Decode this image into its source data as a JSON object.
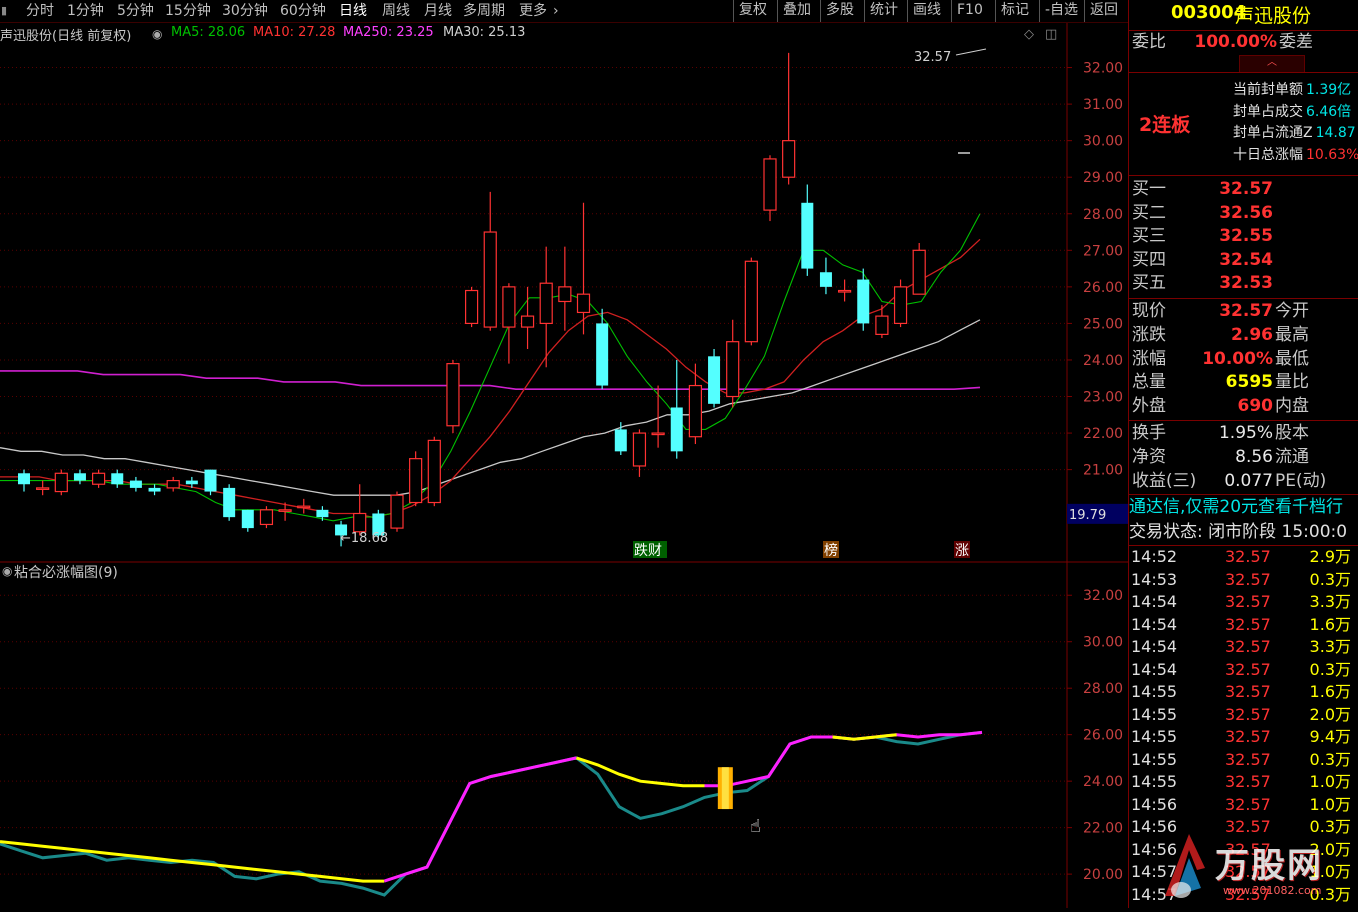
{
  "toolbar": {
    "tabs": [
      "分时",
      "1分钟",
      "5分钟",
      "15分钟",
      "30分钟",
      "60分钟",
      "日线",
      "周线",
      "月线",
      "多周期",
      "更多"
    ],
    "active_tab": "日线",
    "buttons": [
      "复权",
      "叠加",
      "多股",
      "统计",
      "画线",
      "F10",
      "标记",
      "-自选",
      "返回"
    ]
  },
  "main_legend": {
    "title": "声迅股份(日线 前复权)",
    "ma5": "MA5: 28.06",
    "ma10": "MA10: 27.28",
    "ma250": "MA250: 23.25",
    "ma30": "MA30: 25.13"
  },
  "colors": {
    "up": "#ff3232",
    "down": "#54ffff",
    "ma5": "#00c000",
    "ma10": "#d02020",
    "ma250": "#d020d0",
    "ma30": "#c8c8c8",
    "grid": "#5a0000"
  },
  "main_axis": {
    "labels": [
      "32.00",
      "31.00",
      "30.00",
      "29.00",
      "28.00",
      "27.00",
      "26.00",
      "25.00",
      "24.00",
      "23.00",
      "22.00",
      "21.00"
    ],
    "current": "19.79"
  },
  "annotations": {
    "high_label": "32.57",
    "low_label": "18.68",
    "markers": [
      "跌财",
      "榜",
      "涨"
    ]
  },
  "sub_chart": {
    "title": "粘合必涨幅图(9)",
    "axis_labels": [
      "32.00",
      "30.00",
      "28.00",
      "26.00",
      "24.00",
      "22.00",
      "20.00"
    ]
  },
  "stock": {
    "code": "003004",
    "name": "声迅股份",
    "weibi_label": "委比",
    "weibi_value": "100.00%",
    "weicha_label": "委差",
    "lianban": "2连板",
    "info": [
      {
        "label": "当前封单额",
        "value": "1.39亿"
      },
      {
        "label": "封单占成交",
        "value": "6.46倍"
      },
      {
        "label": "封单占流通Z",
        "value": "14.87"
      },
      {
        "label": "十日总涨幅",
        "value": "10.63%"
      }
    ],
    "buy": [
      {
        "label": "买一",
        "price": "32.57"
      },
      {
        "label": "买二",
        "price": "32.56"
      },
      {
        "label": "买三",
        "price": "32.55"
      },
      {
        "label": "买四",
        "price": "32.54"
      },
      {
        "label": "买五",
        "price": "32.53"
      }
    ],
    "quote": [
      {
        "label": "现价",
        "value": "32.57",
        "label2": "今开",
        "cls": "red"
      },
      {
        "label": "涨跌",
        "value": "2.96",
        "label2": "最高",
        "cls": "red"
      },
      {
        "label": "涨幅",
        "value": "10.00%",
        "label2": "最低",
        "cls": "red"
      },
      {
        "label": "总量",
        "value": "6595",
        "label2": "量比",
        "cls": "yellow"
      },
      {
        "label": "外盘",
        "value": "690",
        "label2": "内盘",
        "cls": "red"
      }
    ],
    "quote2": [
      {
        "label": "换手",
        "value": "1.95%",
        "label2": "股本"
      },
      {
        "label": "净资",
        "value": "8.56",
        "label2": "流通"
      },
      {
        "label": "收益(三)",
        "value": "0.077",
        "label2": "PE(动)"
      }
    ],
    "promo": "通达信,仅需20元查看千档行",
    "status": "交易状态: 闭市阶段 15:00:0",
    "ticks": [
      {
        "time": "14:52",
        "price": "32.57",
        "vol": "2.9万"
      },
      {
        "time": "14:53",
        "price": "32.57",
        "vol": "0.3万"
      },
      {
        "time": "14:54",
        "price": "32.57",
        "vol": "3.3万"
      },
      {
        "time": "14:54",
        "price": "32.57",
        "vol": "1.6万"
      },
      {
        "time": "14:54",
        "price": "32.57",
        "vol": "3.3万"
      },
      {
        "time": "14:54",
        "price": "32.57",
        "vol": "0.3万"
      },
      {
        "time": "14:55",
        "price": "32.57",
        "vol": "1.6万"
      },
      {
        "time": "14:55",
        "price": "32.57",
        "vol": "2.0万"
      },
      {
        "time": "14:55",
        "price": "32.57",
        "vol": "9.4万"
      },
      {
        "time": "14:55",
        "price": "32.57",
        "vol": "0.3万"
      },
      {
        "time": "14:55",
        "price": "32.57",
        "vol": "1.0万"
      },
      {
        "time": "14:56",
        "price": "32.57",
        "vol": "1.0万"
      },
      {
        "time": "14:56",
        "price": "32.57",
        "vol": "0.3万"
      },
      {
        "time": "14:56",
        "price": "32.57",
        "vol": "2.0万"
      },
      {
        "time": "14:57",
        "price": "32.57",
        "vol": "1.0万"
      },
      {
        "time": "14:57",
        "price": "32.57",
        "vol": "0.3万"
      }
    ],
    "watermark": "万股网",
    "watermark_url": "www.201082.com"
  },
  "chart_data": {
    "type": "candlestick",
    "ymin": 18.5,
    "ymax": 33.0,
    "candles": [
      {
        "o": 20.9,
        "c": 20.6,
        "h": 21.0,
        "l": 20.4
      },
      {
        "o": 20.5,
        "c": 20.5,
        "h": 20.7,
        "l": 20.3
      },
      {
        "o": 20.4,
        "c": 20.9,
        "h": 21.0,
        "l": 20.3
      },
      {
        "o": 20.9,
        "c": 20.7,
        "h": 21.0,
        "l": 20.6
      },
      {
        "o": 20.6,
        "c": 20.9,
        "h": 21.0,
        "l": 20.5
      },
      {
        "o": 20.9,
        "c": 20.6,
        "h": 21.0,
        "l": 20.5
      },
      {
        "o": 20.7,
        "c": 20.5,
        "h": 20.8,
        "l": 20.4
      },
      {
        "o": 20.5,
        "c": 20.4,
        "h": 20.6,
        "l": 20.3
      },
      {
        "o": 20.5,
        "c": 20.7,
        "h": 20.8,
        "l": 20.4
      },
      {
        "o": 20.7,
        "c": 20.6,
        "h": 20.8,
        "l": 20.5
      },
      {
        "o": 21.0,
        "c": 20.4,
        "h": 21.0,
        "l": 20.3
      },
      {
        "o": 20.5,
        "c": 19.7,
        "h": 20.6,
        "l": 19.6
      },
      {
        "o": 19.9,
        "c": 19.4,
        "h": 19.9,
        "l": 19.3
      },
      {
        "o": 19.5,
        "c": 19.9,
        "h": 20.0,
        "l": 19.4
      },
      {
        "o": 19.9,
        "c": 19.9,
        "h": 20.1,
        "l": 19.6
      },
      {
        "o": 20.0,
        "c": 20.0,
        "h": 20.2,
        "l": 19.8
      },
      {
        "o": 19.9,
        "c": 19.7,
        "h": 20.0,
        "l": 19.6
      },
      {
        "o": 19.5,
        "c": 19.2,
        "h": 19.6,
        "l": 18.9
      },
      {
        "o": 19.3,
        "c": 19.8,
        "h": 20.6,
        "l": 19.2
      },
      {
        "o": 19.8,
        "c": 19.2,
        "h": 19.9,
        "l": 19.1
      },
      {
        "o": 19.4,
        "c": 20.3,
        "h": 20.4,
        "l": 19.3
      },
      {
        "o": 20.1,
        "c": 21.3,
        "h": 21.5,
        "l": 20.0
      },
      {
        "o": 20.1,
        "c": 21.8,
        "h": 21.9,
        "l": 20.0
      },
      {
        "o": 22.2,
        "c": 23.9,
        "h": 24.0,
        "l": 22.0
      },
      {
        "o": 25.0,
        "c": 25.9,
        "h": 26.0,
        "l": 24.9
      },
      {
        "o": 24.9,
        "c": 27.5,
        "h": 28.6,
        "l": 24.8
      },
      {
        "o": 24.9,
        "c": 26.0,
        "h": 26.1,
        "l": 23.9
      },
      {
        "o": 24.9,
        "c": 25.2,
        "h": 26.0,
        "l": 24.3
      },
      {
        "o": 25.0,
        "c": 26.1,
        "h": 27.1,
        "l": 23.8
      },
      {
        "o": 25.6,
        "c": 26.0,
        "h": 27.1,
        "l": 24.8
      },
      {
        "o": 25.3,
        "c": 25.8,
        "h": 28.3,
        "l": 24.7
      },
      {
        "o": 25.0,
        "c": 23.3,
        "h": 25.4,
        "l": 23.2
      },
      {
        "o": 22.1,
        "c": 21.5,
        "h": 22.3,
        "l": 21.4
      },
      {
        "o": 21.1,
        "c": 22.0,
        "h": 22.1,
        "l": 20.8
      },
      {
        "o": 22.0,
        "c": 22.0,
        "h": 23.3,
        "l": 21.6
      },
      {
        "o": 22.7,
        "c": 21.5,
        "h": 24.0,
        "l": 21.3
      },
      {
        "o": 21.9,
        "c": 23.3,
        "h": 23.9,
        "l": 21.7
      },
      {
        "o": 24.1,
        "c": 22.8,
        "h": 24.3,
        "l": 22.7
      },
      {
        "o": 23.0,
        "c": 24.5,
        "h": 25.1,
        "l": 22.7
      },
      {
        "o": 24.5,
        "c": 26.7,
        "h": 26.8,
        "l": 24.4
      },
      {
        "o": 28.1,
        "c": 29.5,
        "h": 29.6,
        "l": 27.8
      },
      {
        "o": 29.0,
        "c": 30.0,
        "h": 32.4,
        "l": 28.8
      },
      {
        "o": 28.3,
        "c": 26.5,
        "h": 28.8,
        "l": 26.3
      },
      {
        "o": 26.4,
        "c": 26.0,
        "h": 26.8,
        "l": 25.8
      },
      {
        "o": 25.9,
        "c": 25.9,
        "h": 26.2,
        "l": 25.6
      },
      {
        "o": 26.2,
        "c": 25.0,
        "h": 26.5,
        "l": 24.8
      },
      {
        "o": 24.7,
        "c": 25.2,
        "h": 25.5,
        "l": 24.6
      },
      {
        "o": 25.0,
        "c": 26.0,
        "h": 26.2,
        "l": 24.9
      },
      {
        "o": 25.8,
        "c": 27.0,
        "h": 27.2,
        "l": 25.8
      }
    ],
    "ma5": [
      20.7,
      20.7,
      20.7,
      20.7,
      20.7,
      20.7,
      20.6,
      20.6,
      20.6,
      20.5,
      20.4,
      20.1,
      19.9,
      19.9,
      19.9,
      19.8,
      19.7,
      19.6,
      19.7,
      19.7,
      19.8,
      20.1,
      20.6,
      21.5,
      22.6,
      23.8,
      25.0,
      25.7,
      25.7,
      25.8,
      25.6,
      25.0,
      24.1,
      23.4,
      22.8,
      22.1,
      22.1,
      22.4,
      23.2,
      24.1,
      25.6,
      27.0,
      27.0,
      26.6,
      26.4,
      25.6,
      25.5,
      25.6,
      26.4,
      27.0,
      28.0
    ],
    "ma10": [
      20.8,
      20.8,
      20.8,
      20.7,
      20.7,
      20.7,
      20.7,
      20.6,
      20.6,
      20.6,
      20.5,
      20.4,
      20.3,
      20.2,
      20.1,
      20.0,
      19.9,
      19.8,
      19.8,
      19.7,
      19.8,
      20.0,
      20.3,
      20.7,
      21.3,
      21.9,
      22.6,
      23.4,
      24.2,
      24.8,
      25.2,
      25.3,
      25.1,
      24.7,
      24.3,
      23.8,
      23.4,
      23.1,
      23.1,
      23.2,
      23.4,
      24.0,
      24.5,
      24.8,
      25.2,
      25.4,
      25.9,
      26.2,
      26.5,
      26.8,
      27.3
    ],
    "ma30": [
      21.6,
      21.5,
      21.5,
      21.4,
      21.4,
      21.3,
      21.3,
      21.2,
      21.1,
      21.0,
      20.9,
      20.8,
      20.7,
      20.6,
      20.5,
      20.4,
      20.3,
      20.3,
      20.3,
      20.3,
      20.4,
      20.6,
      20.8,
      21.0,
      21.2,
      21.3,
      21.5,
      21.7,
      21.9,
      22.0,
      22.2,
      22.3,
      22.5,
      22.5,
      22.6,
      22.8,
      22.9,
      23.0,
      23.1,
      23.3,
      23.5,
      23.7,
      23.9,
      24.1,
      24.3,
      24.5,
      24.8,
      25.1
    ],
    "ma250": [
      23.7,
      23.7,
      23.7,
      23.7,
      23.6,
      23.6,
      23.6,
      23.6,
      23.5,
      23.5,
      23.5,
      23.4,
      23.4,
      23.4,
      23.3,
      23.3,
      23.3,
      23.3,
      23.3,
      23.3,
      23.2,
      23.2,
      23.2,
      23.2,
      23.2,
      23.2,
      23.2,
      23.2,
      23.2,
      23.2,
      23.2,
      23.2,
      23.2,
      23.2,
      23.2,
      23.2,
      23.2,
      23.2,
      23.25
    ],
    "sub": {
      "ymin": 18.8,
      "ymax": 33.0,
      "yellow": [
        21.4,
        21.3,
        21.2,
        21.1,
        21.0,
        20.9,
        20.8,
        20.7,
        20.6,
        20.5,
        20.4,
        20.3,
        20.2,
        20.1,
        20.0,
        19.9,
        19.8,
        19.7,
        19.7,
        20.0,
        20.3,
        22.1,
        23.9,
        24.2,
        24.4,
        24.6,
        24.8,
        25.0,
        24.7,
        24.3,
        24.0,
        23.9,
        23.8,
        23.8,
        23.8,
        24.0,
        24.2,
        25.6,
        25.9,
        25.9,
        25.8,
        25.9,
        26.0,
        25.9,
        26.0,
        26.0,
        26.1
      ],
      "teal": [
        21.3,
        21.0,
        20.7,
        20.8,
        20.9,
        20.6,
        20.7,
        20.6,
        20.5,
        20.6,
        20.5,
        19.9,
        19.8,
        20.0,
        20.1,
        19.7,
        19.6,
        19.4,
        19.1,
        20.0,
        20.3,
        22.1,
        23.9,
        24.2,
        24.4,
        24.6,
        24.8,
        25.0,
        24.3,
        22.9,
        22.4,
        22.6,
        22.9,
        23.3,
        23.5,
        23.6,
        24.2,
        25.6,
        25.9,
        25.9,
        25.8,
        25.9,
        25.7,
        25.6,
        25.8,
        26.0,
        26.1
      ],
      "magenta_from": 18
    }
  }
}
